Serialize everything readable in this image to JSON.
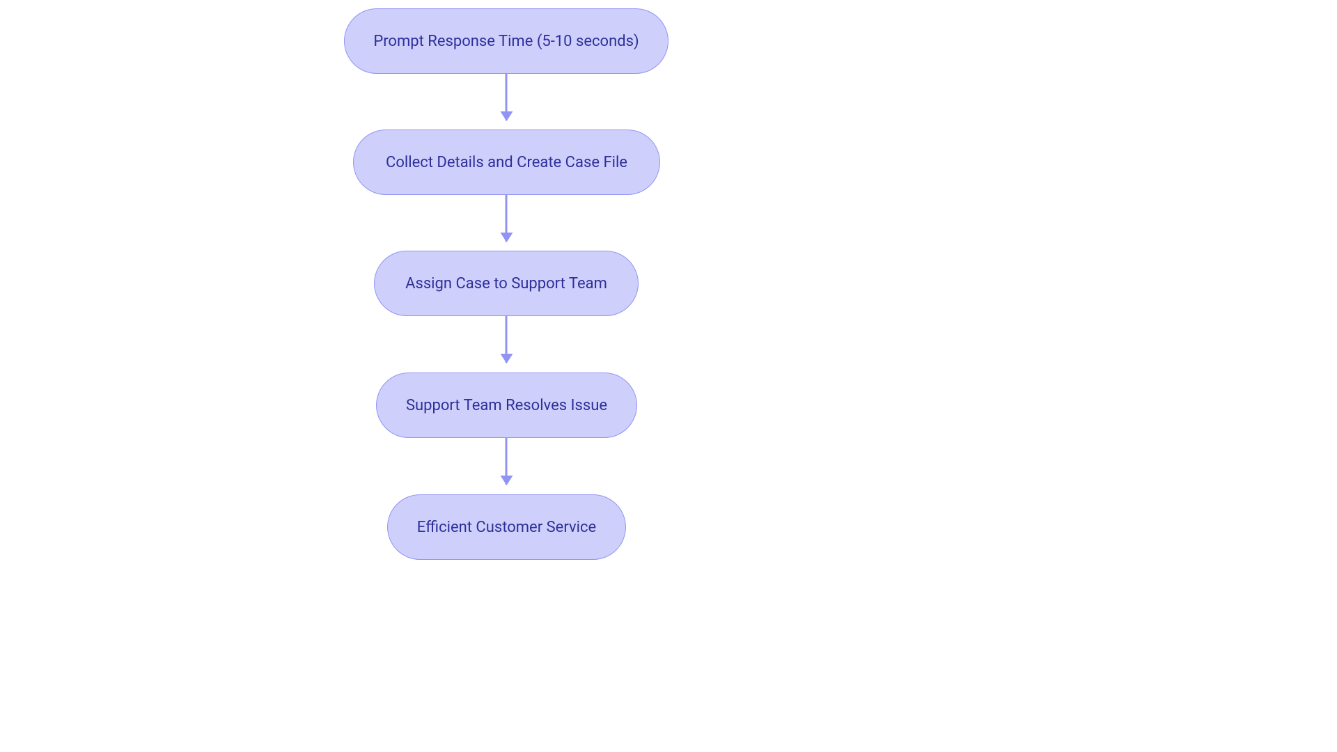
{
  "flowchart": {
    "nodes": [
      {
        "label": "Prompt Response Time (5-10 seconds)"
      },
      {
        "label": "Collect Details and Create Case File"
      },
      {
        "label": "Assign Case to Support Team"
      },
      {
        "label": "Support Team Resolves Issue"
      },
      {
        "label": "Efficient Customer Service"
      }
    ]
  },
  "colors": {
    "node_fill": "#cecffb",
    "node_border": "#9294f5",
    "node_text": "#2d2f9a",
    "arrow": "#9294f5"
  }
}
